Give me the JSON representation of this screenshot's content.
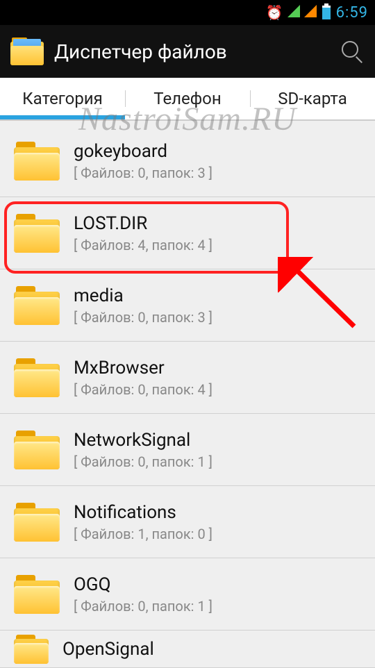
{
  "status": {
    "time": "6:59"
  },
  "header": {
    "title": "Диспетчер файлов"
  },
  "tabs": {
    "items": [
      {
        "label": "Категория"
      },
      {
        "label": "Телефон"
      },
      {
        "label": "SD-карта"
      }
    ]
  },
  "folders": [
    {
      "name": "gokeyboard",
      "meta": "[ Файлов: 0, папок: 3 ]",
      "highlighted": false
    },
    {
      "name": "LOST.DIR",
      "meta": "[ Файлов: 4, папок: 4 ]",
      "highlighted": true
    },
    {
      "name": "media",
      "meta": "[ Файлов: 0, папок: 3 ]",
      "highlighted": false
    },
    {
      "name": "MxBrowser",
      "meta": "[ Файлов: 0, папок: 4 ]",
      "highlighted": false
    },
    {
      "name": "NetworkSignal",
      "meta": "[ Файлов: 0, папок: 1 ]",
      "highlighted": false
    },
    {
      "name": "Notifications",
      "meta": "[ Файлов: 1, папок: 0 ]",
      "highlighted": false
    },
    {
      "name": "OGQ",
      "meta": "[ Файлов: 0, папок: 1 ]",
      "highlighted": false
    },
    {
      "name": "OpenSignal",
      "meta": "",
      "highlighted": false
    }
  ],
  "watermark": "NastroiSam.RU",
  "annotation": {
    "highlight_index": 1
  }
}
